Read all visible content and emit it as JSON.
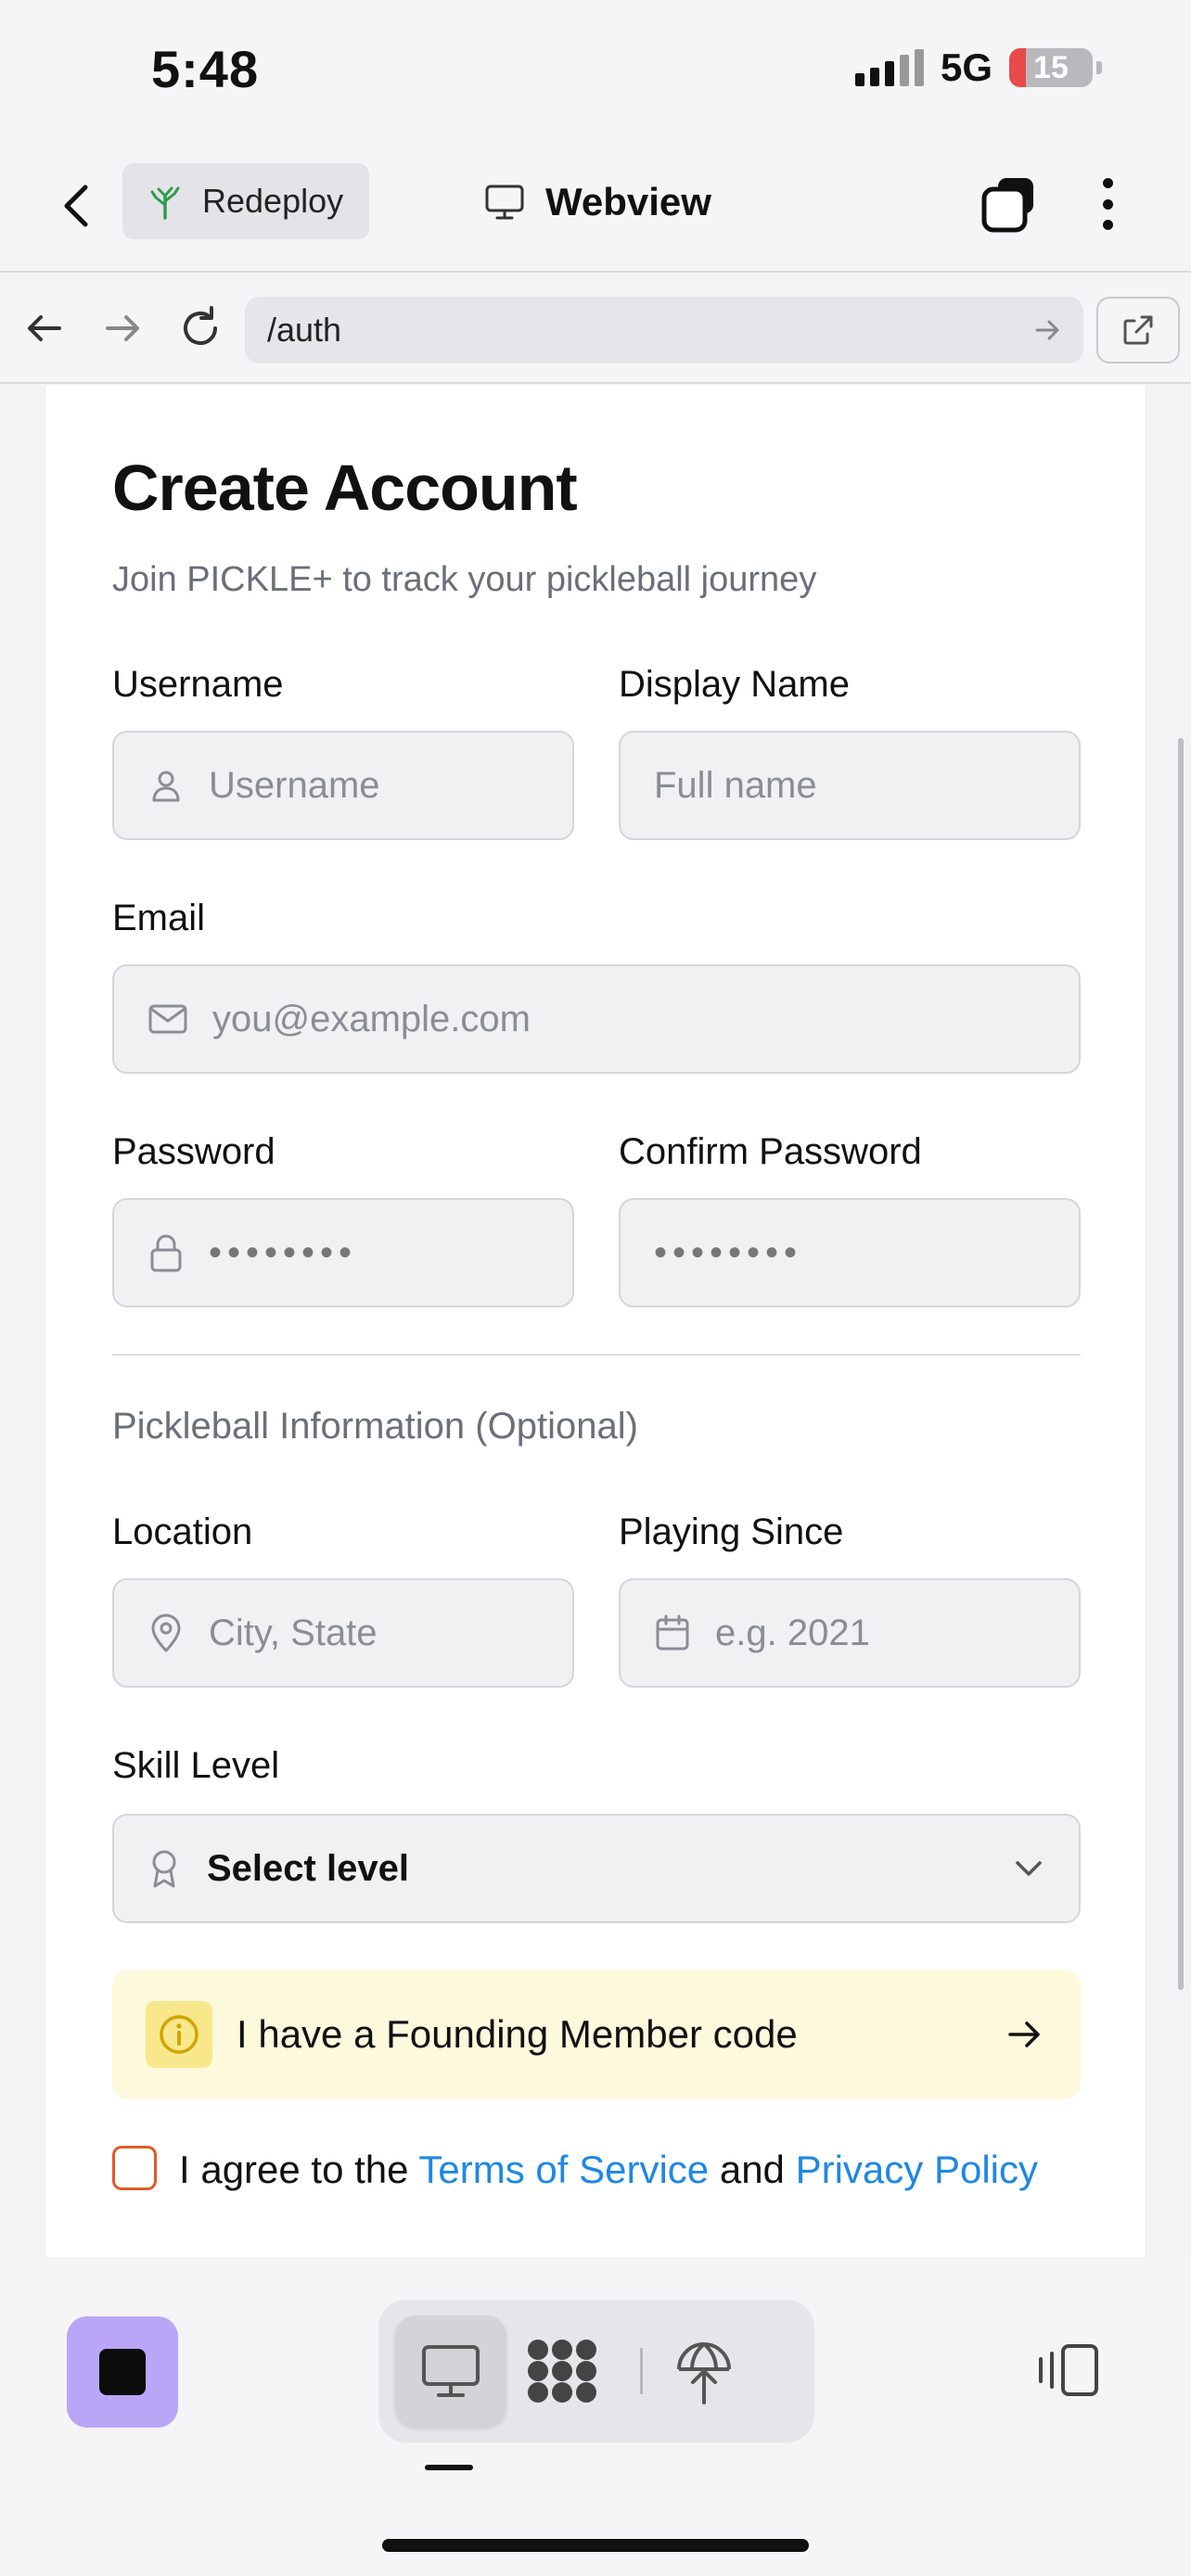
{
  "status": {
    "time": "5:48",
    "network": "5G",
    "battery": "15",
    "battery_level": 0.15
  },
  "header": {
    "redeploy_label": "Redeploy",
    "title": "Webview"
  },
  "browser": {
    "url": "/auth"
  },
  "form": {
    "title": "Create Account",
    "subtitle": "Join PICKLE+ to track your pickleball journey",
    "username": {
      "label": "Username",
      "placeholder": "Username"
    },
    "display_name": {
      "label": "Display Name",
      "placeholder": "Full name"
    },
    "email": {
      "label": "Email",
      "placeholder": "you@example.com"
    },
    "password": {
      "label": "Password",
      "placeholder": "••••••••"
    },
    "confirm_password": {
      "label": "Confirm Password",
      "placeholder": "••••••••"
    },
    "section_title": "Pickleball Information (Optional)",
    "location": {
      "label": "Location",
      "placeholder": "City, State"
    },
    "playing_since": {
      "label": "Playing Since",
      "placeholder": "e.g. 2021"
    },
    "skill_level": {
      "label": "Skill Level",
      "value": "Select level"
    },
    "founding_code": "I have a Founding Member code",
    "agree": {
      "prefix": "I agree to the ",
      "terms": "Terms of Service",
      "and": " and ",
      "privacy": "Privacy Policy",
      "checked": false
    }
  },
  "colors": {
    "accent": "#1e88e5",
    "stop_button": "#b9a6f7",
    "founding_bg": "#fdf9dc",
    "checkbox_border": "#e05a2a"
  },
  "icons": [
    "back-icon",
    "tree-icon",
    "monitor-icon",
    "tabs-icon",
    "more-icon",
    "arrow-left-icon",
    "arrow-right-icon",
    "reload-icon",
    "go-icon",
    "external-link-icon",
    "user-icon",
    "mail-icon",
    "lock-icon",
    "map-pin-icon",
    "calendar-icon",
    "award-icon",
    "chevron-down-icon",
    "info-icon",
    "stop-icon",
    "desktop-icon",
    "workflow-icon",
    "deploy-icon",
    "panel-icon"
  ]
}
